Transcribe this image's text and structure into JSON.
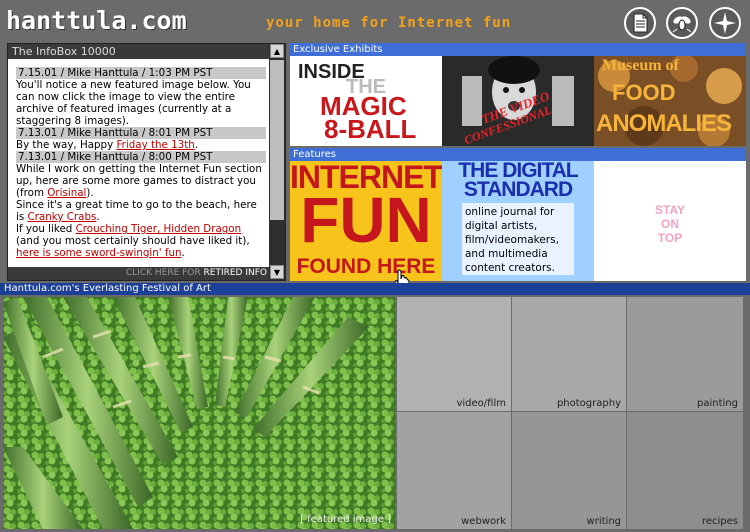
{
  "header": {
    "logo": "hanttula.com",
    "tagline": "your home for Internet fun",
    "icons": [
      "document-icon",
      "fly-icon",
      "compass-icon"
    ]
  },
  "infobox": {
    "title": "The InfoBox 10000",
    "entries": [
      {
        "date": "7.15.01 / Mike Hanttula / 1:03 PM PST",
        "text_before": "You'll notice a new featured image below. You can now click the image to view the entire archive of featured images (currently at a staggering 8 images)."
      },
      {
        "date": "7.13.01 / Mike Hanttula / 8:01 PM PST",
        "text_before": "By the way, Happy ",
        "link": "Friday the 13th",
        "text_after": "."
      },
      {
        "date": "7.13.01 / Mike Hanttula / 8:00 PM PST",
        "text1": "While I work on getting the Internet Fun section up, here are some more games to distract you (from ",
        "link1": "Orisinal",
        "text2": ").",
        "text3": "Since it's a great time to go to the beach, here is ",
        "link2": "Cranky Crabs",
        "text4": ".",
        "text5": "If you liked ",
        "link3": "Crouching Tiger, Hidden Dragon",
        "text6": " (and you most certainly should have liked it), ",
        "link4": "here is some sword-swingin' fun",
        "text7": "."
      }
    ],
    "retired_prefix": "CLICK HERE FOR ",
    "retired_label": "RETIRED INFO"
  },
  "exhibits": {
    "label": "Exclusive Exhibits",
    "items": [
      {
        "line1": "INSIDE",
        "line2": "THE",
        "line3": "MAGIC",
        "line4": "8-BALL"
      },
      {
        "line1": "THE VIDEO",
        "line2": "CONFESSIONAL"
      },
      {
        "line1": "Museum of",
        "line2": "FOOD",
        "line3": "ANOMALIES"
      }
    ]
  },
  "features": {
    "label": "Features",
    "internet_fun": {
      "line1": "INTERNET",
      "line2": "FUN",
      "line3": "FOUND HERE"
    },
    "digital": {
      "title1": "THE DIGITAL",
      "title2": "STANDARD",
      "desc": "online journal for digital artists, film/videomakers, and multimedia content creators."
    },
    "stay": {
      "line1": "STAY",
      "line2": "ON",
      "line3": "TOP"
    }
  },
  "festival": {
    "label": "Hanttula.com's Everlasting Festival of Art",
    "featured_label": "[ featured image ]",
    "categories": [
      "video/film",
      "photography",
      "painting",
      "webwork",
      "writing",
      "recipes"
    ]
  },
  "colors": {
    "accent_orange": "#f3a21a",
    "link_red": "#c00000",
    "section_blue": "#3f6fd6",
    "festival_blue": "#1c3f97"
  }
}
